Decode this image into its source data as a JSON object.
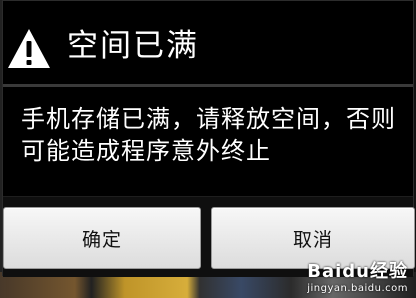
{
  "dialog": {
    "title": "空间已满",
    "message": "手机存储已满，请释放空间，否则可能造成程序意外终止",
    "icon": "warning-icon",
    "buttons": {
      "confirm_label": "确定",
      "cancel_label": "取消"
    }
  },
  "watermark": {
    "brand": "Baidu经验",
    "url": "jingyan.baidu.com"
  },
  "colors": {
    "dialog_background": "#000000",
    "text": "#ffffff",
    "button_background": "#e8e8e8",
    "button_text": "#111111"
  }
}
